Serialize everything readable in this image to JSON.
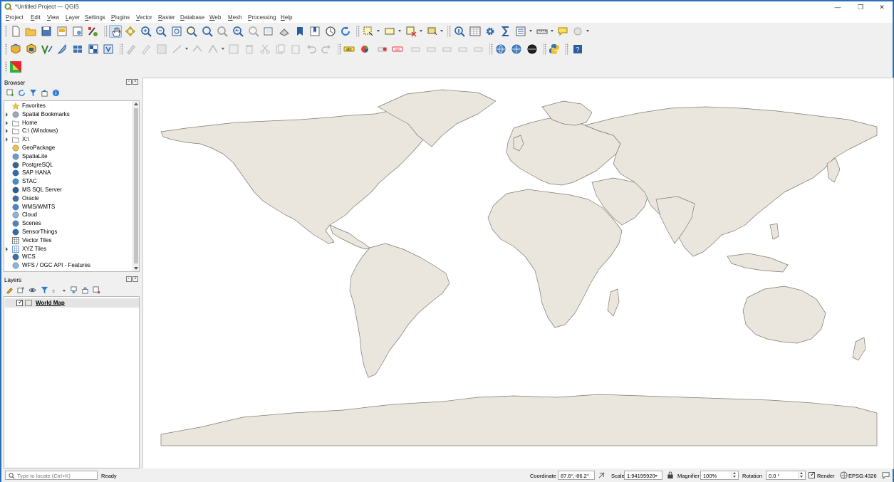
{
  "window": {
    "title": "*Untitled Project — QGIS",
    "minimize": "—",
    "maximize": "❐",
    "close": "✕"
  },
  "menu": [
    "Project",
    "Edit",
    "View",
    "Layer",
    "Settings",
    "Plugins",
    "Vector",
    "Raster",
    "Database",
    "Web",
    "Mesh",
    "Processing",
    "Help"
  ],
  "browser": {
    "title": "Browser",
    "items": [
      {
        "label": "Favorites",
        "icon": "star-icon",
        "expandable": false
      },
      {
        "label": "Spatial Bookmarks",
        "icon": "bookmark-icon",
        "expandable": true
      },
      {
        "label": "Home",
        "icon": "home-folder-icon",
        "expandable": true
      },
      {
        "label": "C:\\ (Windows)",
        "icon": "drive-icon",
        "expandable": true
      },
      {
        "label": "X:\\",
        "icon": "drive-icon",
        "expandable": true
      },
      {
        "label": "GeoPackage",
        "icon": "geopackage-icon",
        "expandable": false
      },
      {
        "label": "SpatiaLite",
        "icon": "spatialite-icon",
        "expandable": false
      },
      {
        "label": "PostgreSQL",
        "icon": "postgresql-icon",
        "expandable": false
      },
      {
        "label": "SAP HANA",
        "icon": "sap-hana-icon",
        "expandable": false
      },
      {
        "label": "STAC",
        "icon": "stac-icon",
        "expandable": false
      },
      {
        "label": "MS SQL Server",
        "icon": "mssql-icon",
        "expandable": false
      },
      {
        "label": "Oracle",
        "icon": "oracle-icon",
        "expandable": false
      },
      {
        "label": "WMS/WMTS",
        "icon": "wms-icon",
        "expandable": false
      },
      {
        "label": "Cloud",
        "icon": "cloud-icon",
        "expandable": false
      },
      {
        "label": "Scenes",
        "icon": "scenes-icon",
        "expandable": false
      },
      {
        "label": "SensorThings",
        "icon": "sensorthings-icon",
        "expandable": false
      },
      {
        "label": "Vector Tiles",
        "icon": "vector-tiles-icon",
        "expandable": false
      },
      {
        "label": "XYZ Tiles",
        "icon": "xyz-tiles-icon",
        "expandable": true
      },
      {
        "label": "WCS",
        "icon": "wcs-icon",
        "expandable": false
      },
      {
        "label": "WFS / OGC API - Features",
        "icon": "wfs-icon",
        "expandable": false
      }
    ]
  },
  "layers": {
    "title": "Layers",
    "items": [
      {
        "label": "World Map",
        "checked": true,
        "check_mark": "✓"
      }
    ]
  },
  "status": {
    "search_placeholder": "Type to locate (Ctrl+K)",
    "ready": "Ready",
    "coordinate_label": "Coordinate",
    "coordinate_value": "87.6°,-86.2°",
    "scale_label": "Scale",
    "scale_value": "1:94195920",
    "magnifier_label": "Magnifier",
    "magnifier_value": "100%",
    "rotation_label": "Rotation",
    "rotation_value": "0.0 °",
    "render_label": "Render",
    "render_checked": true,
    "render_check": "✓",
    "crs": "EPSG:4326"
  },
  "colors": {
    "land": "#eae6dd",
    "coast": "#7d7a72",
    "accent": "#2a6fb5"
  }
}
